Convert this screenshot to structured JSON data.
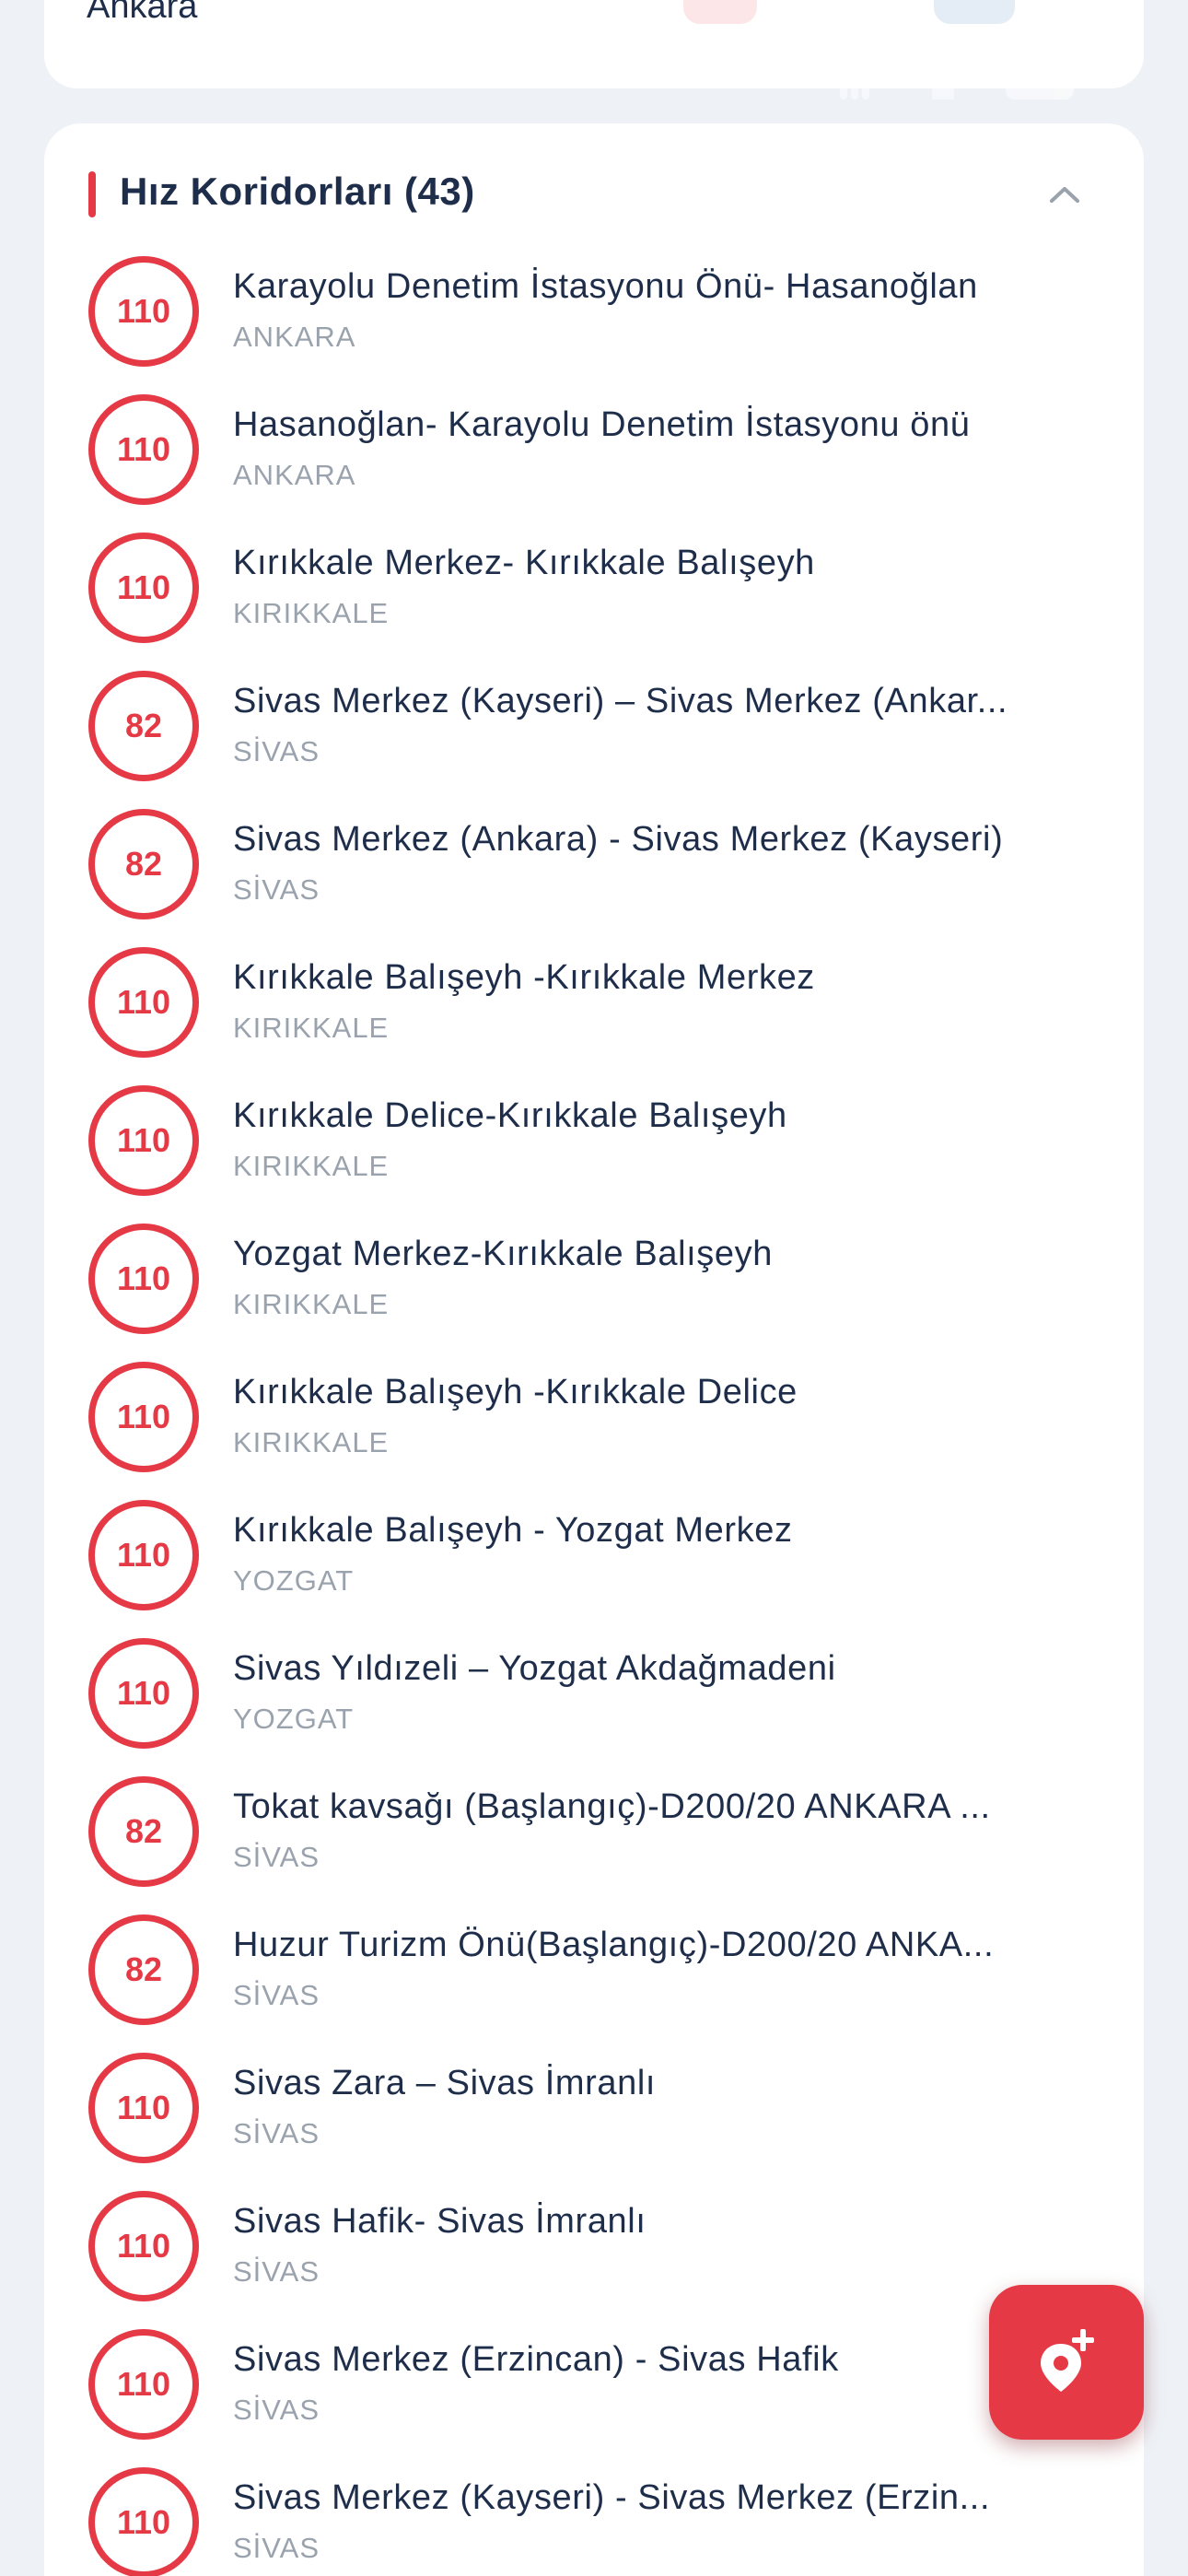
{
  "previous_card": {
    "city_label": "Ankara"
  },
  "section": {
    "title": "Hız Koridorları (43)"
  },
  "accent_color": "#e63946",
  "corridors": [
    {
      "speed": "110",
      "name": "Karayolu Denetim İstasyonu Önü- Hasanoğlan",
      "city": "ANKARA"
    },
    {
      "speed": "110",
      "name": "Hasanoğlan- Karayolu Denetim İstasyonu önü",
      "city": "ANKARA"
    },
    {
      "speed": "110",
      "name": "Kırıkkale Merkez- Kırıkkale Balışeyh",
      "city": "KIRIKKALE"
    },
    {
      "speed": "82",
      "name": "Sivas Merkez (Kayseri) – Sivas Merkez (Ankar...",
      "city": "SİVAS"
    },
    {
      "speed": "82",
      "name": "Sivas Merkez (Ankara) - Sivas Merkez (Kayseri)",
      "city": "SİVAS"
    },
    {
      "speed": "110",
      "name": "Kırıkkale Balışeyh -Kırıkkale Merkez",
      "city": "KIRIKKALE"
    },
    {
      "speed": "110",
      "name": "Kırıkkale Delice-Kırıkkale Balışeyh",
      "city": "KIRIKKALE"
    },
    {
      "speed": "110",
      "name": "Yozgat Merkez-Kırıkkale Balışeyh",
      "city": "KIRIKKALE"
    },
    {
      "speed": "110",
      "name": "Kırıkkale Balışeyh -Kırıkkale Delice",
      "city": "KIRIKKALE"
    },
    {
      "speed": "110",
      "name": "Kırıkkale Balışeyh - Yozgat Merkez",
      "city": "YOZGAT"
    },
    {
      "speed": "110",
      "name": "Sivas Yıldızeli – Yozgat Akdağmadeni",
      "city": "YOZGAT"
    },
    {
      "speed": "82",
      "name": "Tokat kavsağı (Başlangıç)-D200/20 ANKARA ...",
      "city": "SİVAS"
    },
    {
      "speed": "82",
      "name": "Huzur Turizm Önü(Başlangıç)-D200/20 ANKA...",
      "city": "SİVAS"
    },
    {
      "speed": "110",
      "name": "Sivas Zara – Sivas İmranlı",
      "city": "SİVAS"
    },
    {
      "speed": "110",
      "name": "Sivas Hafik- Sivas İmranlı",
      "city": "SİVAS"
    },
    {
      "speed": "110",
      "name": "Sivas Merkez (Erzincan) - Sivas Hafik",
      "city": "SİVAS"
    },
    {
      "speed": "110",
      "name": "Sivas Merkez (Kayseri) - Sivas Merkez (Erzin...",
      "city": "SİVAS"
    }
  ],
  "icons": {
    "collapse": "chevron-up-icon",
    "fab": "add-location-pin-icon"
  }
}
